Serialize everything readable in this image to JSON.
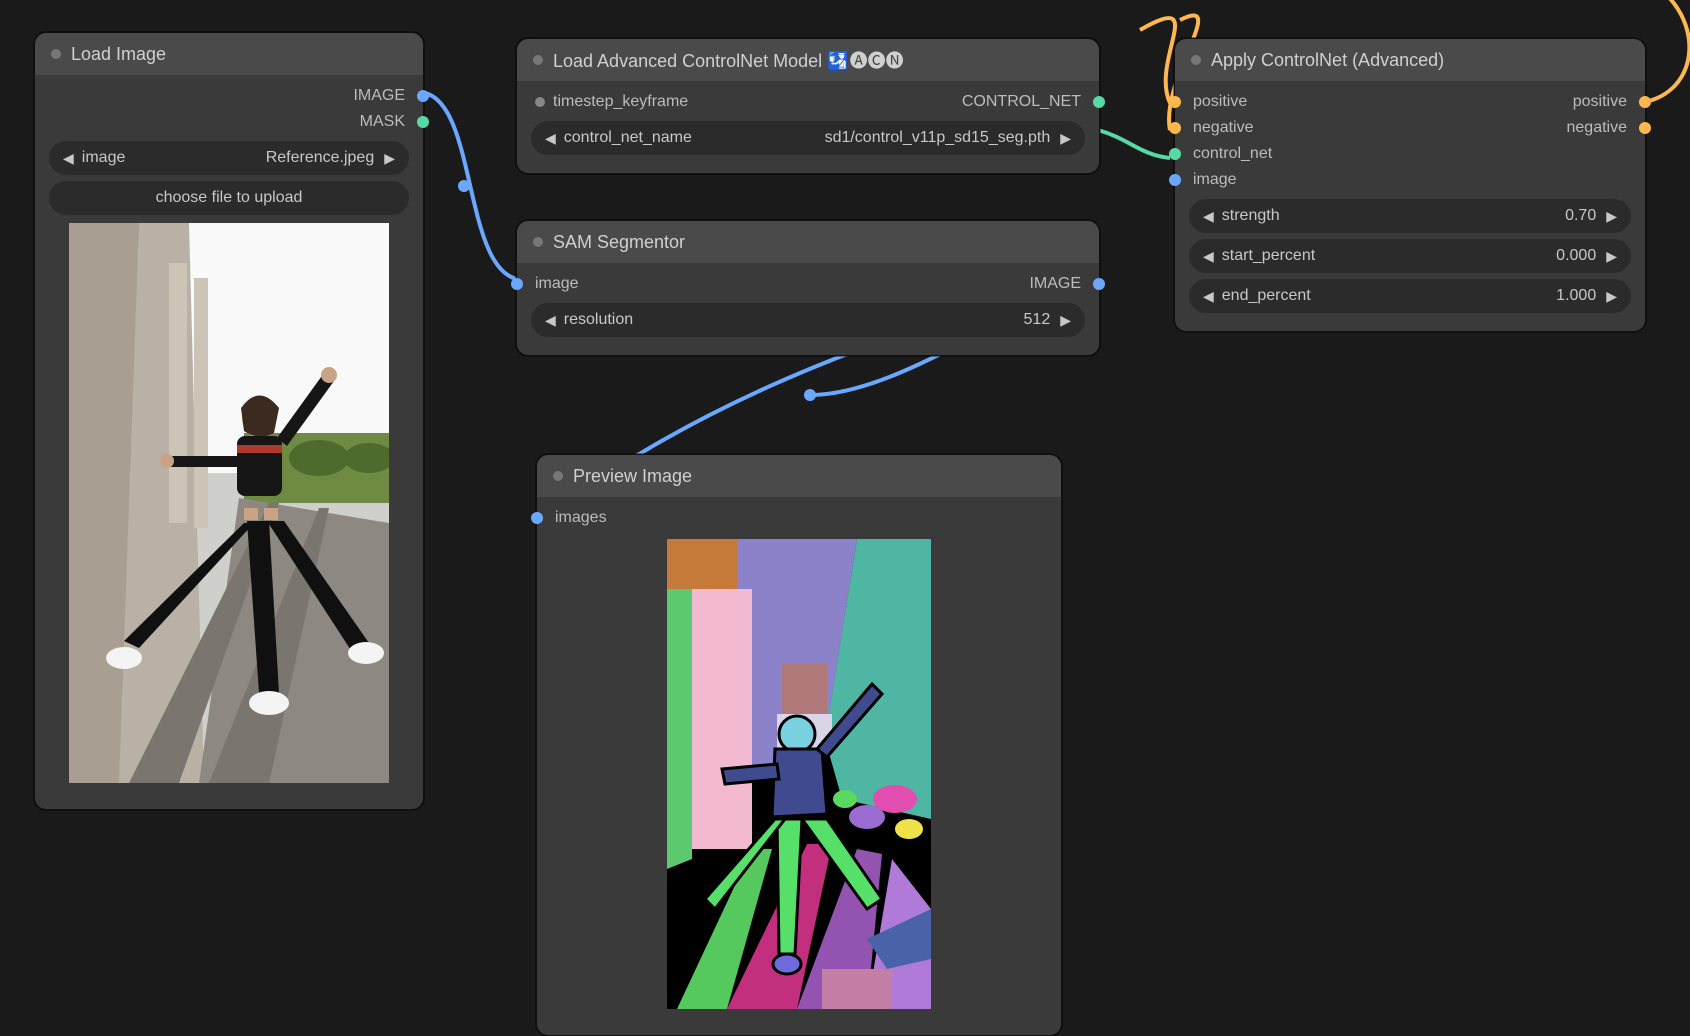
{
  "nodes": {
    "load_image": {
      "title": "Load Image",
      "outputs": {
        "image": "IMAGE",
        "mask": "MASK"
      },
      "widgets": {
        "image_label": "image",
        "image_value": "Reference.jpeg",
        "upload_btn": "choose file to upload"
      }
    },
    "load_cn": {
      "title": "Load Advanced ControlNet Model 🛂🅐🅒🅝",
      "inputs": {
        "timestep_keyframe": "timestep_keyframe"
      },
      "outputs": {
        "control_net": "CONTROL_NET"
      },
      "widgets": {
        "name_label": "control_net_name",
        "name_value": "sd1/control_v11p_sd15_seg.pth"
      }
    },
    "sam": {
      "title": "SAM Segmentor",
      "inputs": {
        "image": "image"
      },
      "outputs": {
        "image": "IMAGE"
      },
      "widgets": {
        "res_label": "resolution",
        "res_value": "512"
      }
    },
    "apply_cn": {
      "title": "Apply ControlNet (Advanced)",
      "inputs": {
        "positive": "positive",
        "negative": "negative",
        "control_net": "control_net",
        "image": "image"
      },
      "outputs": {
        "positive": "positive",
        "negative": "negative"
      },
      "widgets": {
        "strength_label": "strength",
        "strength_value": "0.70",
        "start_label": "start_percent",
        "start_value": "0.000",
        "end_label": "end_percent",
        "end_value": "1.000"
      }
    },
    "preview": {
      "title": "Preview Image",
      "inputs": {
        "images": "images"
      }
    }
  }
}
